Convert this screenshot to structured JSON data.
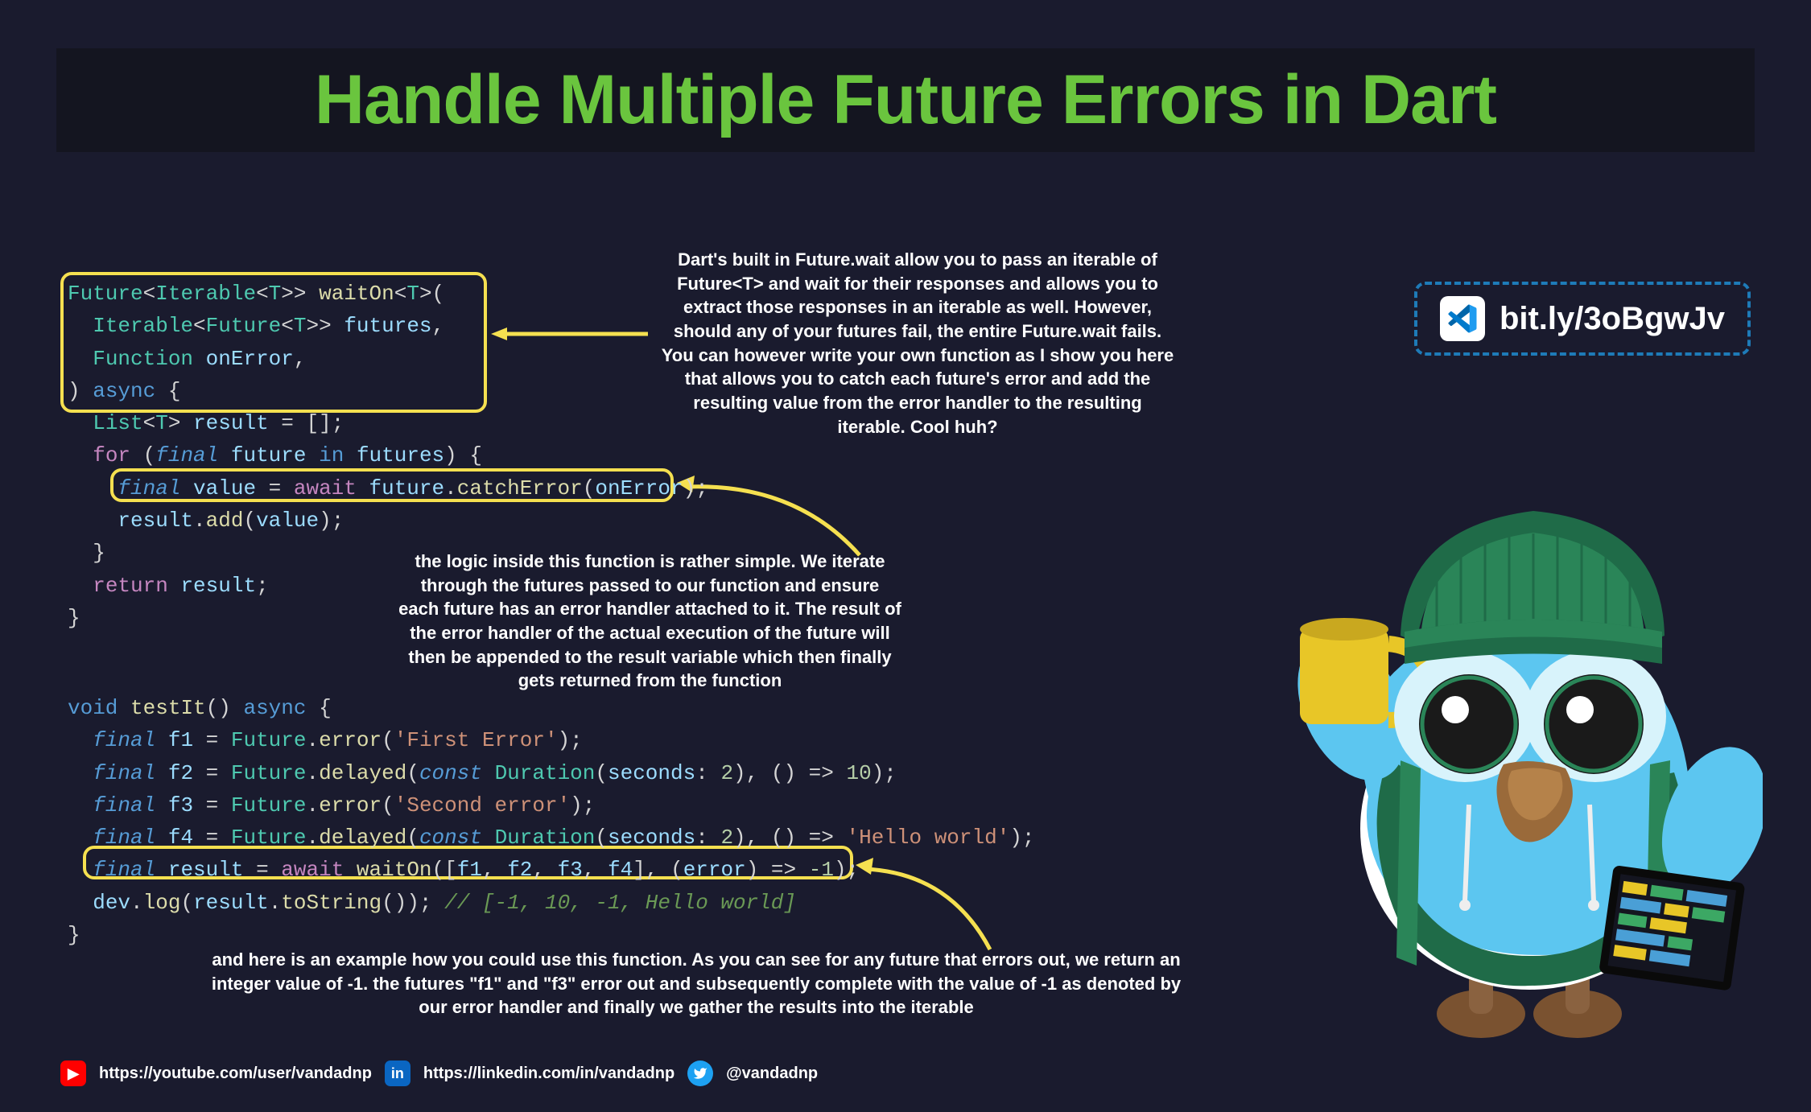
{
  "title": "Handle Multiple Future Errors in Dart",
  "link": {
    "text": "bit.ly/3oBgwJv"
  },
  "explain": {
    "top": "Dart's built in Future.wait allow you to pass an iterable of Future<T> and wait for their responses and allows you to extract those responses in an iterable as well. However, should any of your futures fail, the entire Future.wait fails. You can however write your own function as I show you here that allows you to catch each future's error and add the resulting value from the error handler to the resulting iterable. Cool huh?",
    "mid": "the logic inside this function is rather simple. We iterate through the futures passed to our function and ensure each future has an error handler attached to it. The result of the error handler of the actual execution of the future will then be appended to the result variable which then finally gets returned from the function",
    "bottom": "and here is an example how you could use this function. As you can see for any future that errors out, we return an integer value of -1. the futures \"f1\" and \"f3\" error out and subsequently complete with the value of -1 as denoted by our error handler and finally we gather the results into the iterable"
  },
  "code1": {
    "l1a": "Future",
    "l1b": "<",
    "l1c": "Iterable",
    "l1d": "<",
    "l1e": "T",
    "l1f": ">> ",
    "l1g": "waitOn",
    "l1h": "<",
    "l1i": "T",
    "l1j": ">(",
    "l2a": "  ",
    "l2b": "Iterable",
    "l2c": "<",
    "l2d": "Future",
    "l2e": "<",
    "l2f": "T",
    "l2g": ">> ",
    "l2h": "futures",
    "l2i": ",",
    "l3a": "  ",
    "l3b": "Function",
    "l3c": " ",
    "l3d": "onError",
    "l3e": ",",
    "l4a": ") ",
    "l4b": "async",
    "l4c": " {",
    "l5a": "  ",
    "l5b": "List",
    "l5c": "<",
    "l5d": "T",
    "l5e": "> ",
    "l5f": "result",
    "l5g": " = [];",
    "l6a": "  ",
    "l6b": "for",
    "l6c": " (",
    "l6d": "final",
    "l6e": " ",
    "l6f": "future",
    "l6g": " ",
    "l6h": "in",
    "l6i": " ",
    "l6j": "futures",
    "l6k": ") {",
    "l7a": "    ",
    "l7b": "final",
    "l7c": " ",
    "l7d": "value",
    "l7e": " = ",
    "l7f": "await",
    "l7g": " ",
    "l7h": "future",
    "l7i": ".",
    "l7j": "catchError",
    "l7k": "(",
    "l7l": "onError",
    "l7m": ");",
    "l8a": "    ",
    "l8b": "result",
    "l8c": ".",
    "l8d": "add",
    "l8e": "(",
    "l8f": "value",
    "l8g": ");",
    "l9a": "  }",
    "l10a": "  ",
    "l10b": "return",
    "l10c": " ",
    "l10d": "result",
    "l10e": ";",
    "l11a": "}"
  },
  "code2": {
    "l1a": "void",
    "l1b": " ",
    "l1c": "testIt",
    "l1d": "() ",
    "l1e": "async",
    "l1f": " {",
    "l2a": "  ",
    "l2b": "final",
    "l2c": " ",
    "l2d": "f1",
    "l2e": " = ",
    "l2f": "Future",
    "l2g": ".",
    "l2h": "error",
    "l2i": "(",
    "l2j": "'First Error'",
    "l2k": ");",
    "l3a": "  ",
    "l3b": "final",
    "l3c": " ",
    "l3d": "f2",
    "l3e": " = ",
    "l3f": "Future",
    "l3g": ".",
    "l3h": "delayed",
    "l3i": "(",
    "l3j": "const",
    "l3k": " ",
    "l3l": "Duration",
    "l3m": "(",
    "l3n": "seconds",
    "l3o": ": ",
    "l3p": "2",
    "l3q": "), () => ",
    "l3r": "10",
    "l3s": ");",
    "l4a": "  ",
    "l4b": "final",
    "l4c": " ",
    "l4d": "f3",
    "l4e": " = ",
    "l4f": "Future",
    "l4g": ".",
    "l4h": "error",
    "l4i": "(",
    "l4j": "'Second error'",
    "l4k": ");",
    "l5a": "  ",
    "l5b": "final",
    "l5c": " ",
    "l5d": "f4",
    "l5e": " = ",
    "l5f": "Future",
    "l5g": ".",
    "l5h": "delayed",
    "l5i": "(",
    "l5j": "const",
    "l5k": " ",
    "l5l": "Duration",
    "l5m": "(",
    "l5n": "seconds",
    "l5o": ": ",
    "l5p": "2",
    "l5q": "), () => ",
    "l5r": "'Hello world'",
    "l5s": ");",
    "l6a": "  ",
    "l6b": "final",
    "l6c": " ",
    "l6d": "result",
    "l6e": " = ",
    "l6f": "await",
    "l6g": " ",
    "l6h": "waitOn",
    "l6i": "([",
    "l6j": "f1",
    "l6k": ", ",
    "l6l": "f2",
    "l6m": ", ",
    "l6n": "f3",
    "l6o": ", ",
    "l6p": "f4",
    "l6q": "], (",
    "l6r": "error",
    "l6s": ") => ",
    "l6t": "-1",
    "l6u": ");",
    "l7a": "  ",
    "l7b": "dev",
    "l7c": ".",
    "l7d": "log",
    "l7e": "(",
    "l7f": "result",
    "l7g": ".",
    "l7h": "toString",
    "l7i": "()); ",
    "l7j": "// [-1, 10, -1, Hello world]",
    "l8a": "}"
  },
  "footer": {
    "youtube": "https://youtube.com/user/vandadnp",
    "linkedin": "https://linkedin.com/in/vandadnp",
    "twitter": "@vandadnp"
  }
}
